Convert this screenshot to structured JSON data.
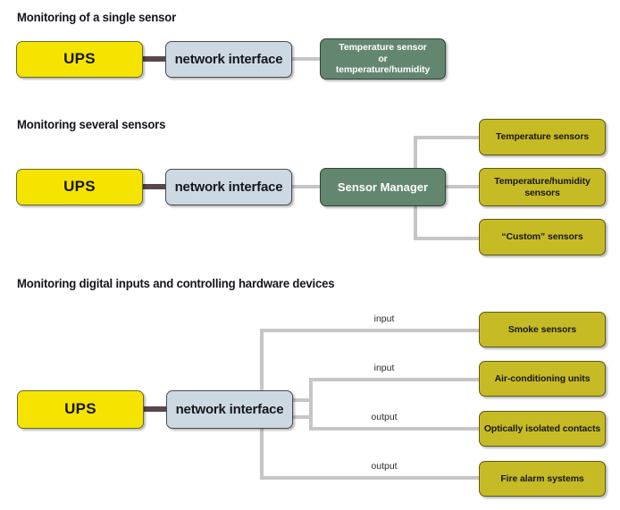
{
  "sections": [
    {
      "heading": "Monitoring of a single sensor",
      "nodes": {
        "ups": "UPS",
        "network_interface": "network interface",
        "sensor": "Temperature sensor\nor\ntemperature/humidity"
      }
    },
    {
      "heading": "Monitoring several sensors",
      "nodes": {
        "ups": "UPS",
        "network_interface": "network interface",
        "sensor_manager": "Sensor Manager",
        "sensors": [
          "Temperature sensors",
          "Temperature/humidity\nsensors",
          "“Custom” sensors"
        ]
      }
    },
    {
      "heading": "Monitoring digital inputs and controlling hardware devices",
      "nodes": {
        "ups": "UPS",
        "network_interface": "network interface",
        "devices": [
          {
            "label": "Smoke sensors",
            "io": "input"
          },
          {
            "label": "Air-conditioning units",
            "io": "input"
          },
          {
            "label": "Optically isolated contacts",
            "io": "output"
          },
          {
            "label": "Fire alarm systems",
            "io": "output"
          }
        ]
      }
    }
  ],
  "colors": {
    "ups_fill": "#f5e400",
    "network_interface_fill": "#ccd9e3",
    "sensor_green_fill": "#63866f",
    "device_olive_fill": "#c6bb24",
    "connector_light": "#c6c6c6",
    "connector_dark": "#57474b",
    "background": "#ffffff",
    "text_dark": "#17171b"
  }
}
